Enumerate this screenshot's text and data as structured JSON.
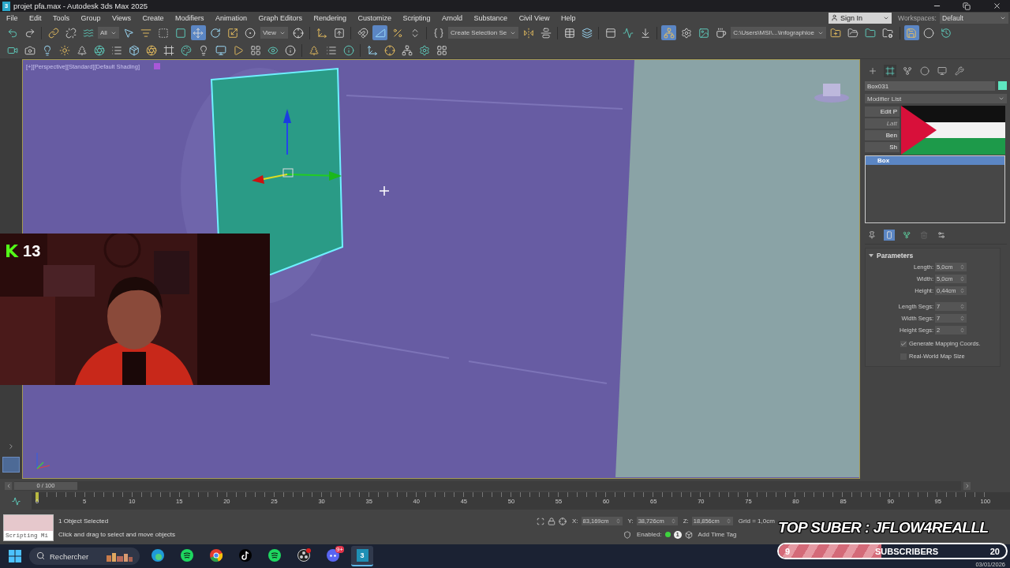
{
  "window": {
    "app_icon": "3",
    "title": "projet pfa.max - Autodesk 3ds Max 2025"
  },
  "menu": [
    "File",
    "Edit",
    "Tools",
    "Group",
    "Views",
    "Create",
    "Modifiers",
    "Animation",
    "Graph Editors",
    "Rendering",
    "Customize",
    "Scripting",
    "Arnold",
    "Substance",
    "Civil View",
    "Help"
  ],
  "account": {
    "sign_in": "Sign In",
    "workspaces_label": "Workspaces:",
    "workspace": "Default"
  },
  "main_toolbar": [
    {
      "kind": "tool",
      "selected": false
    },
    {
      "kind": "tool",
      "selected": false
    },
    {
      "kind": "separator"
    },
    {
      "kind": "tool",
      "selected": false
    },
    {
      "kind": "tool",
      "selected": false
    },
    {
      "kind": "tool",
      "selected": false
    },
    {
      "kind": "dropdown",
      "value": "All"
    },
    {
      "kind": "tool",
      "selected": false
    },
    {
      "kind": "tool",
      "selected": false
    },
    {
      "kind": "tool",
      "selected": false
    },
    {
      "kind": "tool",
      "selected": false
    },
    {
      "kind": "tool",
      "selected": true
    },
    {
      "kind": "tool",
      "selected": false
    },
    {
      "kind": "tool",
      "selected": false
    },
    {
      "kind": "tool",
      "selected": false
    },
    {
      "kind": "dropdown",
      "value": "View"
    },
    {
      "kind": "tool",
      "selected": false
    },
    {
      "kind": "separator"
    },
    {
      "kind": "tool",
      "selected": false
    },
    {
      "kind": "tool",
      "selected": false
    },
    {
      "kind": "separator"
    },
    {
      "kind": "tool",
      "selected": false
    },
    {
      "kind": "tool",
      "selected": true
    },
    {
      "kind": "tool",
      "selected": false
    },
    {
      "kind": "tool",
      "selected": false
    },
    {
      "kind": "separator"
    },
    {
      "kind": "tool",
      "selected": false
    },
    {
      "kind": "dropdown",
      "value": "Create Selection Se"
    },
    {
      "kind": "tool",
      "selected": false
    },
    {
      "kind": "tool",
      "selected": false
    },
    {
      "kind": "separator"
    },
    {
      "kind": "tool",
      "selected": false
    },
    {
      "kind": "tool",
      "selected": false
    },
    {
      "kind": "separator"
    },
    {
      "kind": "tool",
      "selected": false
    },
    {
      "kind": "tool",
      "selected": false
    },
    {
      "kind": "tool",
      "selected": false
    },
    {
      "kind": "separator"
    },
    {
      "kind": "tool",
      "selected": true
    },
    {
      "kind": "tool",
      "selected": false
    },
    {
      "kind": "tool",
      "selected": false
    },
    {
      "kind": "tool",
      "selected": false
    },
    {
      "kind": "dropdown",
      "value": "C:\\Users\\MSI\\...\\infographioe"
    },
    {
      "kind": "tool",
      "selected": false
    },
    {
      "kind": "tool",
      "selected": false
    },
    {
      "kind": "tool",
      "selected": false
    },
    {
      "kind": "tool",
      "selected": false
    },
    {
      "kind": "separator"
    },
    {
      "kind": "tool",
      "selected": true
    },
    {
      "kind": "tool",
      "selected": false
    },
    {
      "kind": "tool",
      "selected": false
    }
  ],
  "second_toolbar": [
    {
      "kind": "tool",
      "selected": false
    },
    {
      "kind": "tool",
      "selected": false
    },
    {
      "kind": "tool",
      "selected": false
    },
    {
      "kind": "tool",
      "selected": false
    },
    {
      "kind": "tool",
      "selected": false
    },
    {
      "kind": "tool",
      "selected": false
    },
    {
      "kind": "tool",
      "selected": false
    },
    {
      "kind": "tool",
      "selected": false
    },
    {
      "kind": "tool",
      "selected": false
    },
    {
      "kind": "tool",
      "selected": false
    },
    {
      "kind": "tool",
      "selected": false
    },
    {
      "kind": "tool",
      "selected": false
    },
    {
      "kind": "tool",
      "selected": false
    },
    {
      "kind": "tool",
      "selected": false
    },
    {
      "kind": "tool",
      "selected": false
    },
    {
      "kind": "tool",
      "selected": false
    },
    {
      "kind": "tool",
      "selected": false
    },
    {
      "kind": "separator"
    },
    {
      "kind": "tool",
      "selected": false
    },
    {
      "kind": "tool",
      "selected": false
    },
    {
      "kind": "tool",
      "selected": false
    },
    {
      "kind": "separator"
    },
    {
      "kind": "tool",
      "selected": false
    },
    {
      "kind": "tool",
      "selected": false
    },
    {
      "kind": "tool",
      "selected": false
    },
    {
      "kind": "tool",
      "selected": false
    },
    {
      "kind": "tool",
      "selected": false
    }
  ],
  "viewport": {
    "label": "[+][Perspective][Standard][Default Shading]"
  },
  "webcam": {
    "viewers_logo": "K",
    "viewers": "13"
  },
  "command_panel": {
    "tabs": [
      {
        "selected": false
      },
      {
        "selected": true
      },
      {
        "selected": false
      },
      {
        "selected": false
      },
      {
        "selected": false
      },
      {
        "selected": false
      }
    ],
    "object_name": "Box031",
    "modifier_list": "Modifier List",
    "modifier_buttons": [
      {
        "label": "Edit P",
        "disabled": false
      },
      {
        "label": "Latt",
        "disabled": true
      },
      {
        "label": "Ben",
        "disabled": false
      },
      {
        "label": "Sh",
        "disabled": false
      }
    ],
    "stack": [
      {
        "label": "Box",
        "selected": true
      }
    ],
    "rollout": {
      "title": "Parameters",
      "expanded": true,
      "fields": [
        {
          "label": "Length:",
          "value": "5,0cm"
        },
        {
          "label": "Width:",
          "value": "5,0cm"
        },
        {
          "label": "Height:",
          "value": "0,44cm"
        },
        {
          "label": "Length Segs:",
          "value": "7"
        },
        {
          "label": "Width Segs:",
          "value": "7"
        },
        {
          "label": "Height Segs:",
          "value": "2"
        }
      ],
      "checkboxes": [
        {
          "label": "Generate Mapping Coords.",
          "checked": true
        },
        {
          "label": "Real-World Map Size",
          "checked": false
        }
      ]
    }
  },
  "timeline": {
    "frame": "0 / 100",
    "ticks": [
      "0",
      "5",
      "10",
      "15",
      "20",
      "25",
      "30",
      "35",
      "40",
      "45",
      "50",
      "55",
      "60",
      "65",
      "70",
      "75",
      "80",
      "85",
      "90",
      "95",
      "100"
    ]
  },
  "status": {
    "listener": "Scripting Mi",
    "selection": "1 Object Selected",
    "prompt": "Click and drag to select and move objects",
    "coords": [
      {
        "axis": "X:",
        "value": "83,169cm"
      },
      {
        "axis": "Y:",
        "value": "38,726cm"
      },
      {
        "axis": "Z:",
        "value": "18,856cm"
      }
    ],
    "grid": "Grid = 1,0cm",
    "enabled_label": "Enabled:",
    "enabled": true,
    "time_tags": "1",
    "add_time_tag": "Add Time Tag"
  },
  "stream": {
    "top_suber": "TOP SUBER : JFLOW4REALLL",
    "goal": {
      "current": "9",
      "label": "SUBSCRIBERS",
      "target": "20",
      "level": 0.45
    }
  },
  "taskbar": {
    "search_placeholder": "Rechercher",
    "apps": [
      {
        "kind": "edge",
        "active": false
      },
      {
        "kind": "spotify",
        "active": false
      },
      {
        "kind": "chrome",
        "active": false
      },
      {
        "kind": "tiktok",
        "active": false
      },
      {
        "kind": "spotify",
        "active": false
      },
      {
        "kind": "obs",
        "active": false
      },
      {
        "kind": "discord",
        "active": false,
        "badge": "9+"
      },
      {
        "kind": "max",
        "active": true,
        "text": "3"
      }
    ],
    "date": "03/01/2026"
  }
}
